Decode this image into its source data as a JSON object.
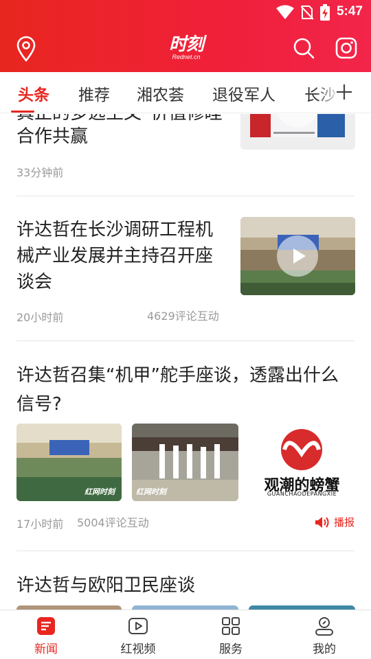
{
  "status": {
    "time": "5:47"
  },
  "app": {
    "logo_main": "时刻",
    "logo_sub": "Rednet.cn"
  },
  "tabs": [
    {
      "label": "头条"
    },
    {
      "label": "推荐"
    },
    {
      "label": "湘农荟"
    },
    {
      "label": "退役军人"
    },
    {
      "label": "长沙"
    }
  ],
  "feed": {
    "item0": {
      "title_line1": "真正的多逃王文“价值修睦",
      "title_line2": "合作共赢",
      "time": "33分钟前"
    },
    "item1": {
      "title_line1": "许达哲在长沙调研工程机",
      "title_line2": "械产业发展并主持召开座",
      "title_line3": "谈会",
      "time": "20小时前",
      "comments": "4629评论互动"
    },
    "item2": {
      "title_line1": "许达哲召集“机甲”舵手座谈，透露出什么",
      "title_line2": "信号?",
      "time": "17小时前",
      "comments": "5004评论互动",
      "report": "播报",
      "logo_cn": "观潮的螃蟹",
      "logo_en": "GUANCHAODEPANGXIE",
      "watermark": "红网时刻"
    },
    "item3": {
      "title": "许达哲与欧阳卫民座谈"
    }
  },
  "bottom_nav": [
    {
      "label": "新闻"
    },
    {
      "label": "红视频"
    },
    {
      "label": "服务"
    },
    {
      "label": "我的"
    }
  ],
  "colors": {
    "brand_red": "#e8261f",
    "meta_gray": "#999999"
  }
}
